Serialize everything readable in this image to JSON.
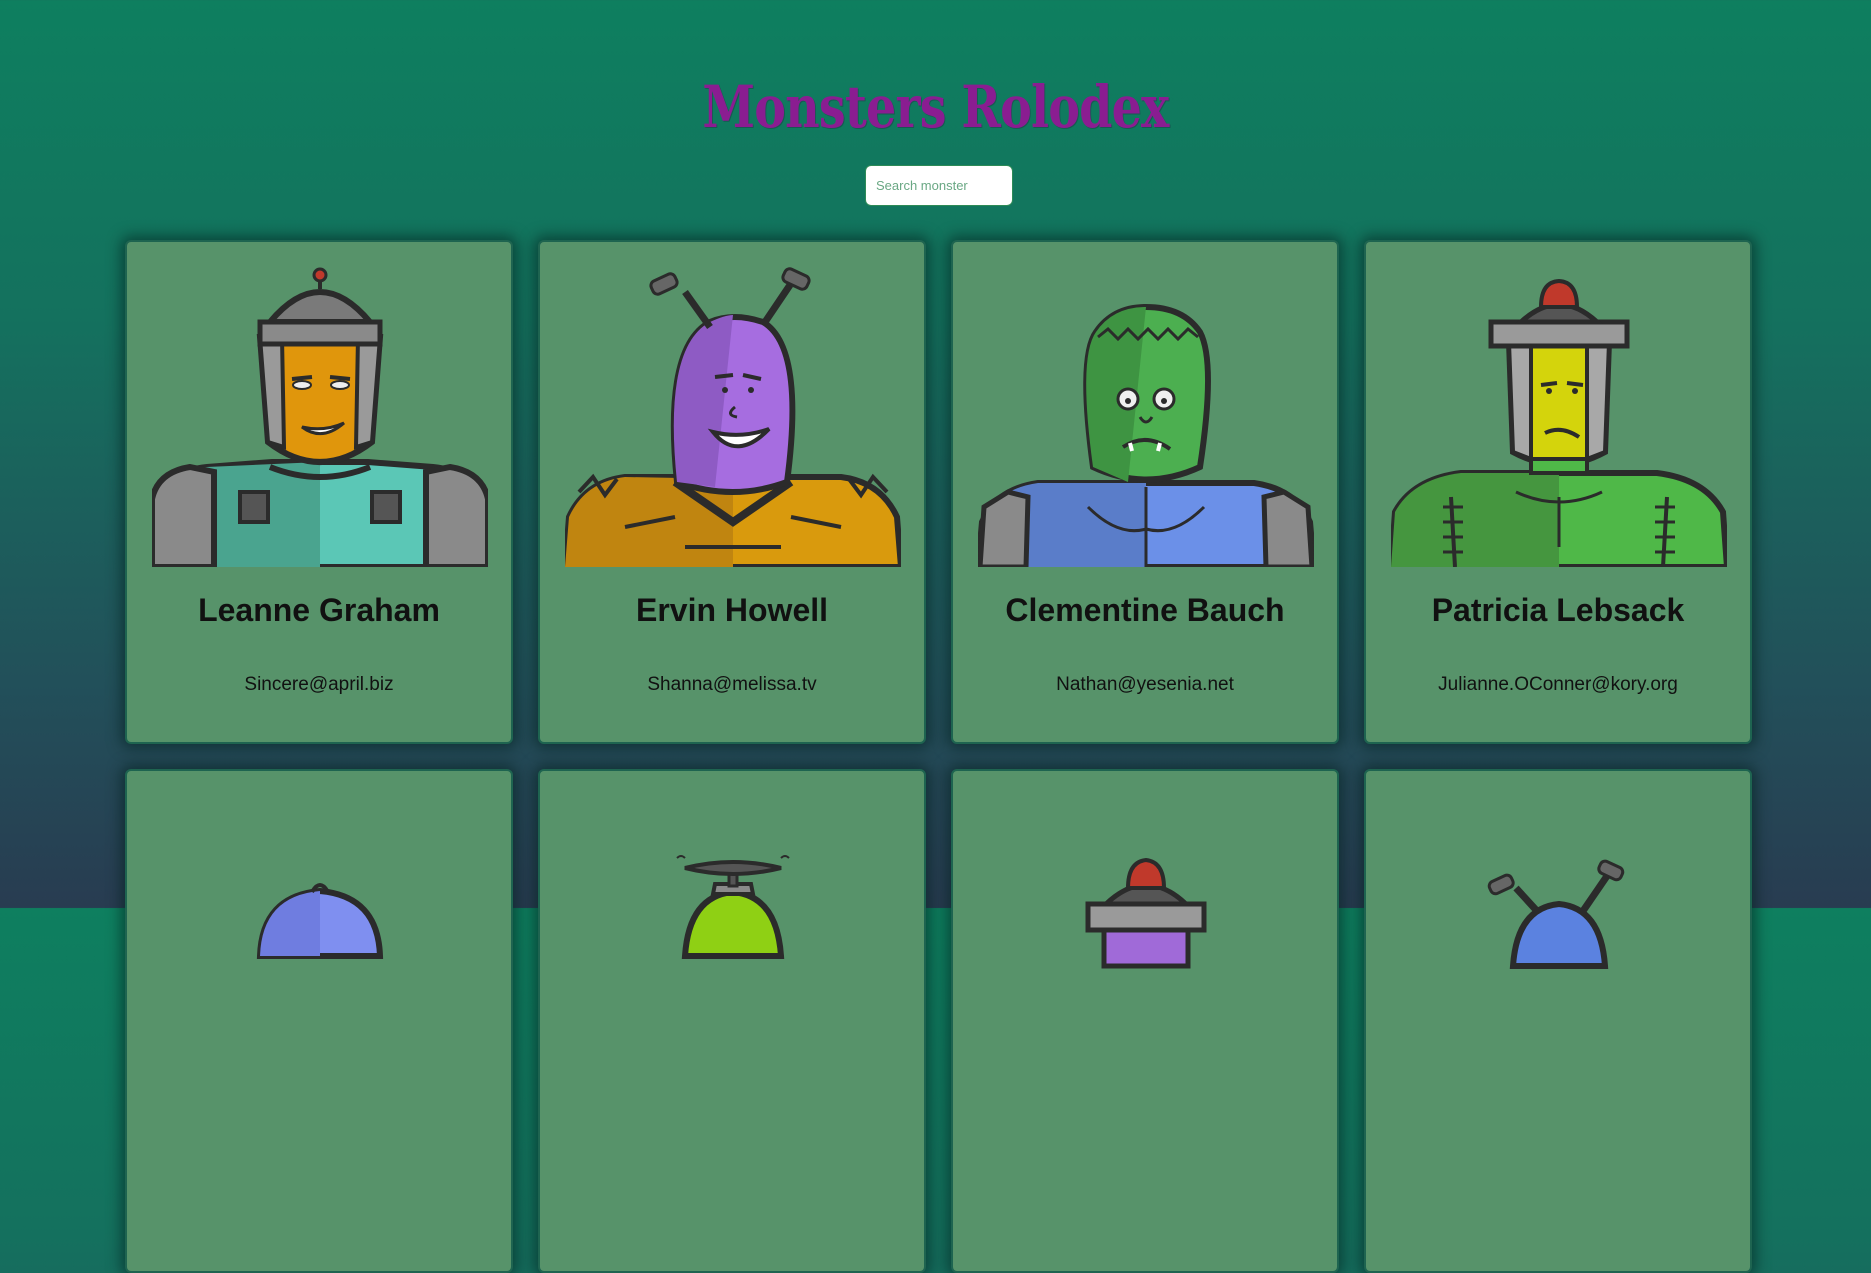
{
  "app": {
    "title": "Monsters Rolodex"
  },
  "search": {
    "placeholder": "Search monster",
    "value": ""
  },
  "monsters": [
    {
      "name": "Leanne Graham",
      "email": "Sincere@april.biz",
      "icon": "robot-monster-icon"
    },
    {
      "name": "Ervin Howell",
      "email": "Shanna@melissa.tv",
      "icon": "antenna-monster-icon"
    },
    {
      "name": "Clementine Bauch",
      "email": "Nathan@yesenia.net",
      "icon": "frankenstein-monster-icon"
    },
    {
      "name": "Patricia Lebsack",
      "email": "Julianne.OConner@kory.org",
      "icon": "siren-monster-icon"
    },
    {
      "name": "",
      "email": "",
      "icon": "blob-monster-icon"
    },
    {
      "name": "",
      "email": "",
      "icon": "propeller-monster-icon"
    },
    {
      "name": "",
      "email": "",
      "icon": "siren-monster-icon"
    },
    {
      "name": "",
      "email": "",
      "icon": "antenna-monster-icon"
    }
  ],
  "colors": {
    "title": "#8a1d91",
    "card_background": "#57936a",
    "card_border": "#1e6450"
  }
}
